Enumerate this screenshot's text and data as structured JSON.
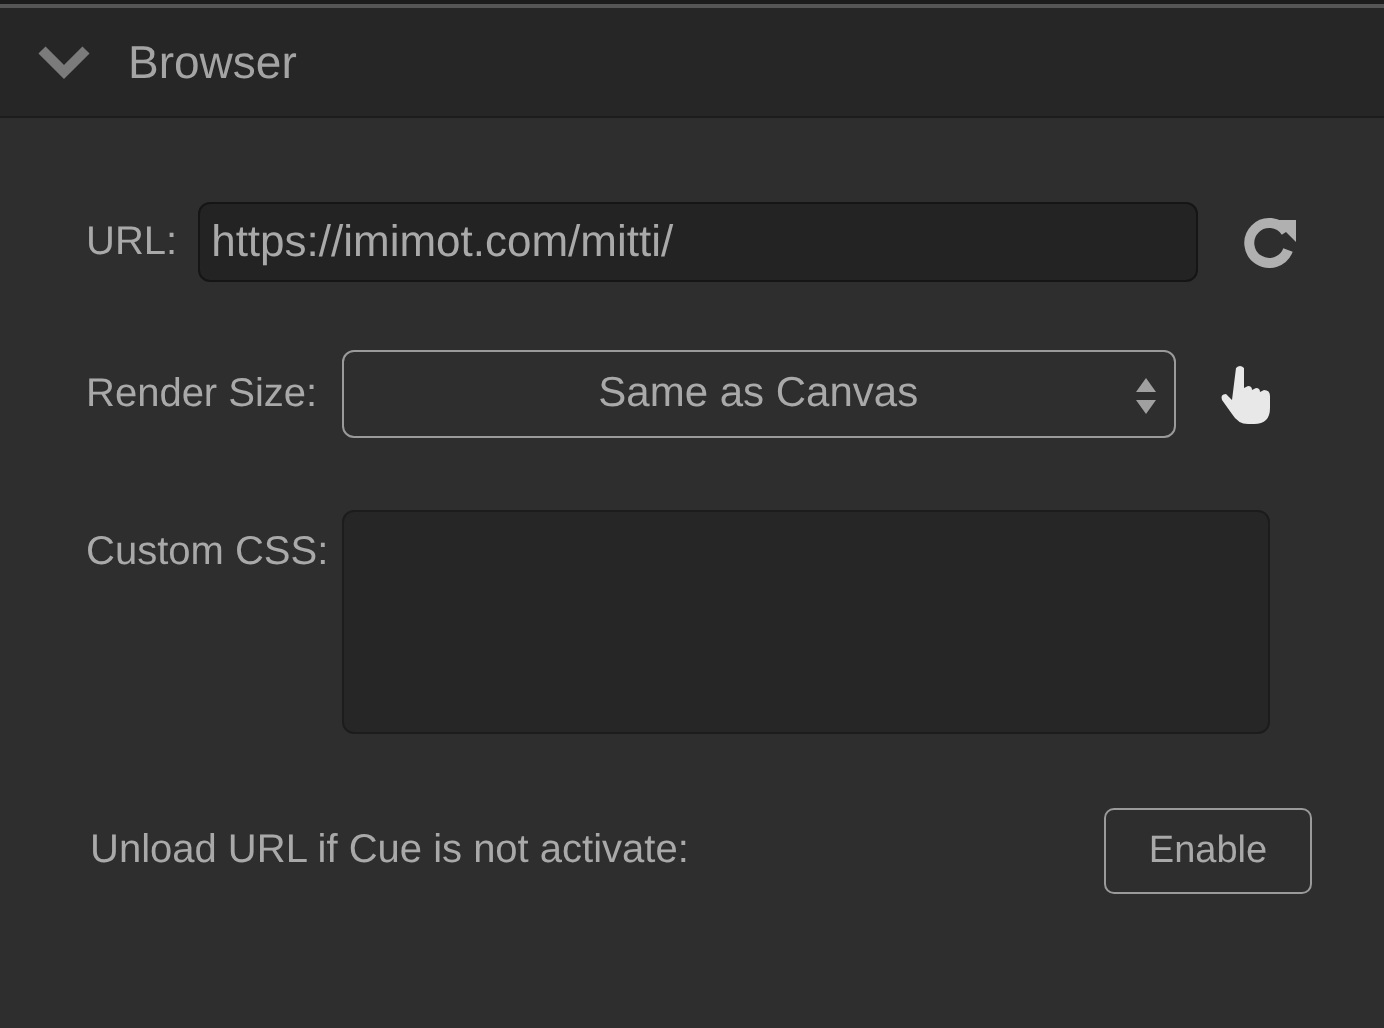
{
  "panel": {
    "title": "Browser",
    "expanded": true
  },
  "url": {
    "label": "URL:",
    "value": "https://imimot.com/mitti/"
  },
  "render_size": {
    "label": "Render Size:",
    "value": "Same as Canvas"
  },
  "custom_css": {
    "label": "Custom CSS:"
  },
  "unload": {
    "label": "Unload URL if Cue is not activate:",
    "button": "Enable"
  }
}
